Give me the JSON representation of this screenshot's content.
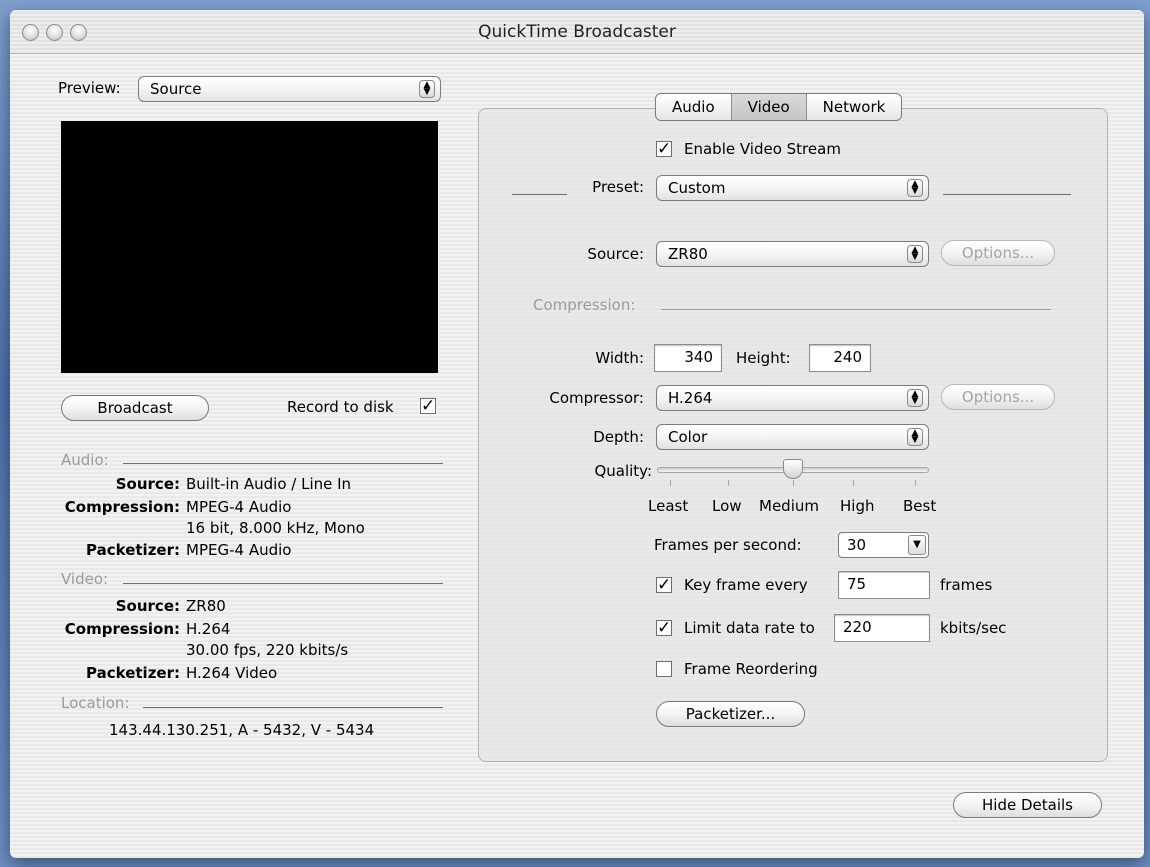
{
  "window": {
    "title": "QuickTime Broadcaster"
  },
  "preview": {
    "label": "Preview:",
    "value": "Source"
  },
  "actions": {
    "broadcast": "Broadcast",
    "record_label": "Record to disk",
    "record_checked": true,
    "hide_details": "Hide Details"
  },
  "audio": {
    "heading": "Audio:",
    "source_label": "Source:",
    "source": "Built-in Audio / Line In",
    "compression_label": "Compression:",
    "compression": "MPEG-4 Audio",
    "compression_detail": "16 bit, 8.000 kHz, Mono",
    "packetizer_label": "Packetizer:",
    "packetizer": "MPEG-4 Audio"
  },
  "video": {
    "heading": "Video:",
    "source_label": "Source:",
    "source": "ZR80",
    "compression_label": "Compression:",
    "compression": "H.264",
    "compression_detail": "30.00 fps, 220 kbits/s",
    "packetizer_label": "Packetizer:",
    "packetizer": "H.264 Video"
  },
  "location": {
    "heading": "Location:",
    "value": "143.44.130.251, A - 5432, V - 5434"
  },
  "tabs": [
    {
      "label": "Audio",
      "active": false
    },
    {
      "label": "Video",
      "active": true
    },
    {
      "label": "Network",
      "active": false
    }
  ],
  "settings": {
    "enable_label": "Enable Video Stream",
    "enable_checked": true,
    "preset_label": "Preset:",
    "preset": "Custom",
    "source_label": "Source:",
    "source": "ZR80",
    "options": "Options...",
    "compression_heading": "Compression:",
    "width_label": "Width:",
    "width": "340",
    "height_label": "Height:",
    "height": "240",
    "compressor_label": "Compressor:",
    "compressor": "H.264",
    "depth_label": "Depth:",
    "depth": "Color",
    "quality_label": "Quality:",
    "quality_ticks": [
      "Least",
      "Low",
      "Medium",
      "High",
      "Best"
    ],
    "quality_level": "Medium",
    "fps_label": "Frames per second:",
    "fps": "30",
    "keyframe_label": "Key frame every",
    "keyframe": "75",
    "keyframe_unit": "frames",
    "keyframe_checked": true,
    "limit_label": "Limit data rate to",
    "limit": "220",
    "limit_unit": "kbits/sec",
    "limit_checked": true,
    "reorder_label": "Frame Reordering",
    "reorder_checked": false,
    "packetizer": "Packetizer..."
  }
}
